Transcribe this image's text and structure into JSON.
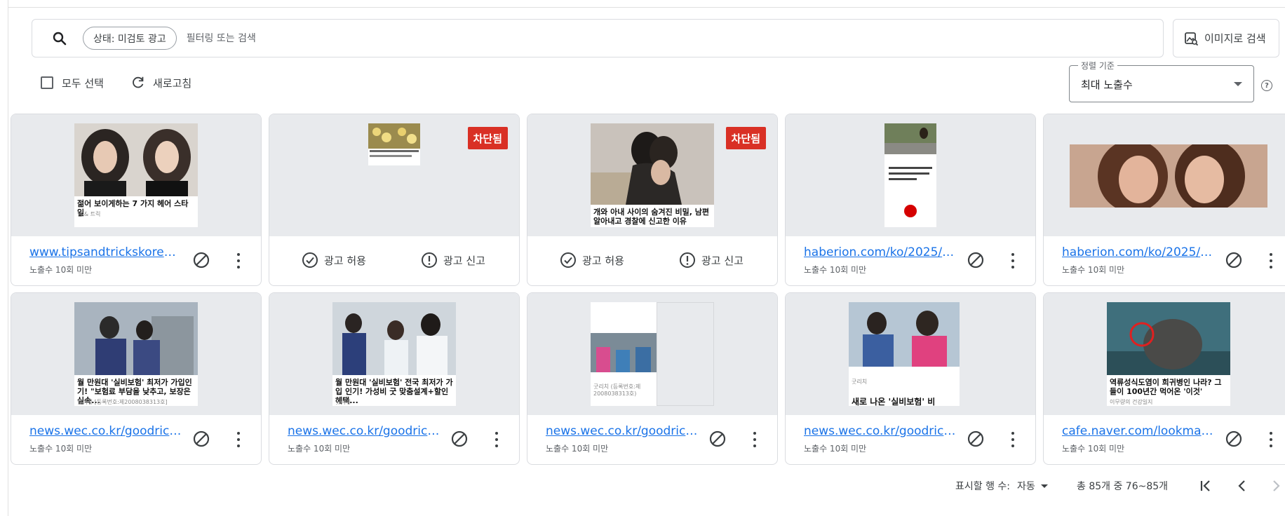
{
  "search": {
    "chip_label": "상태: 미검토 광고",
    "placeholder": "필터링 또는 검색",
    "image_search_label": "이미지로 검색"
  },
  "toolbar": {
    "select_all_label": "모두 선택",
    "refresh_label": "새로고침",
    "sort_legend": "정렬 기준",
    "sort_value": "최대 노출수"
  },
  "card_actions": {
    "allow_label": "광고 허용",
    "report_label": "광고 신고",
    "blocked_badge": "차단됨"
  },
  "cards": [
    {
      "url": "www.tipsandtrickskorea.c...",
      "impressions": "노출수 10회 미만",
      "caption": "젊어 보이게하는 7 가지 헤어 스타일",
      "source": "팁 & 트릭"
    },
    {
      "url": "",
      "impressions": "",
      "caption": "",
      "source": "",
      "blocked": true
    },
    {
      "url": "",
      "impressions": "",
      "caption": "개와 아내 사이의 숨겨진 비밀, 남편 알아내고 경찰에 신고한 이유",
      "source": "",
      "blocked": true
    },
    {
      "url": "haberion.com/ko/2025/0...",
      "impressions": "노출수 10회 미만",
      "caption": "",
      "source": ""
    },
    {
      "url": "haberion.com/ko/2025/0...",
      "impressions": "노출수 10회 미만",
      "caption": "",
      "source": ""
    },
    {
      "url": "news.wec.co.kr/goodrich...",
      "impressions": "노출수 10회 미만",
      "caption": "월 만원대 '실비보험' 최저가 가입인기! \"보험료 부담을 낮추고, 보장은 실속...",
      "source": "굿리치 [등록번호:제2008038313호]"
    },
    {
      "url": "news.wec.co.kr/goodrich...",
      "impressions": "노출수 10회 미만",
      "caption": "월 만원대 '실비보험' 전국 최저가 가입 인기! 가성비 굿 맞춤설계+할인혜택...",
      "source": "굿리치"
    },
    {
      "url": "news.wec.co.kr/goodrich...",
      "impressions": "노출수 10회 미만",
      "caption": "",
      "source": "굿리치 (등록번호:제 2008038313호)"
    },
    {
      "url": "news.wec.co.kr/goodrich...",
      "impressions": "노출수 10회 미만",
      "caption": "새로 나온 '실비보험' 비",
      "source": "굿리치"
    },
    {
      "url": "cafe.naver.com/lookman/...",
      "impressions": "노출수 10회 미만",
      "caption": "역류성식도염이 희귀병인 나라? 그들이 100년간 먹어온 '이것'",
      "source": "이무량의 건강일지"
    }
  ],
  "footer": {
    "rows_label": "표시할 행 수:",
    "rows_value": "자동",
    "range_label": "총 85개 중 76~85개"
  },
  "colors": {
    "accent_link": "#1a73e8",
    "blocked_badge": "#d93025",
    "thumb_bg": "#e8eaed"
  }
}
